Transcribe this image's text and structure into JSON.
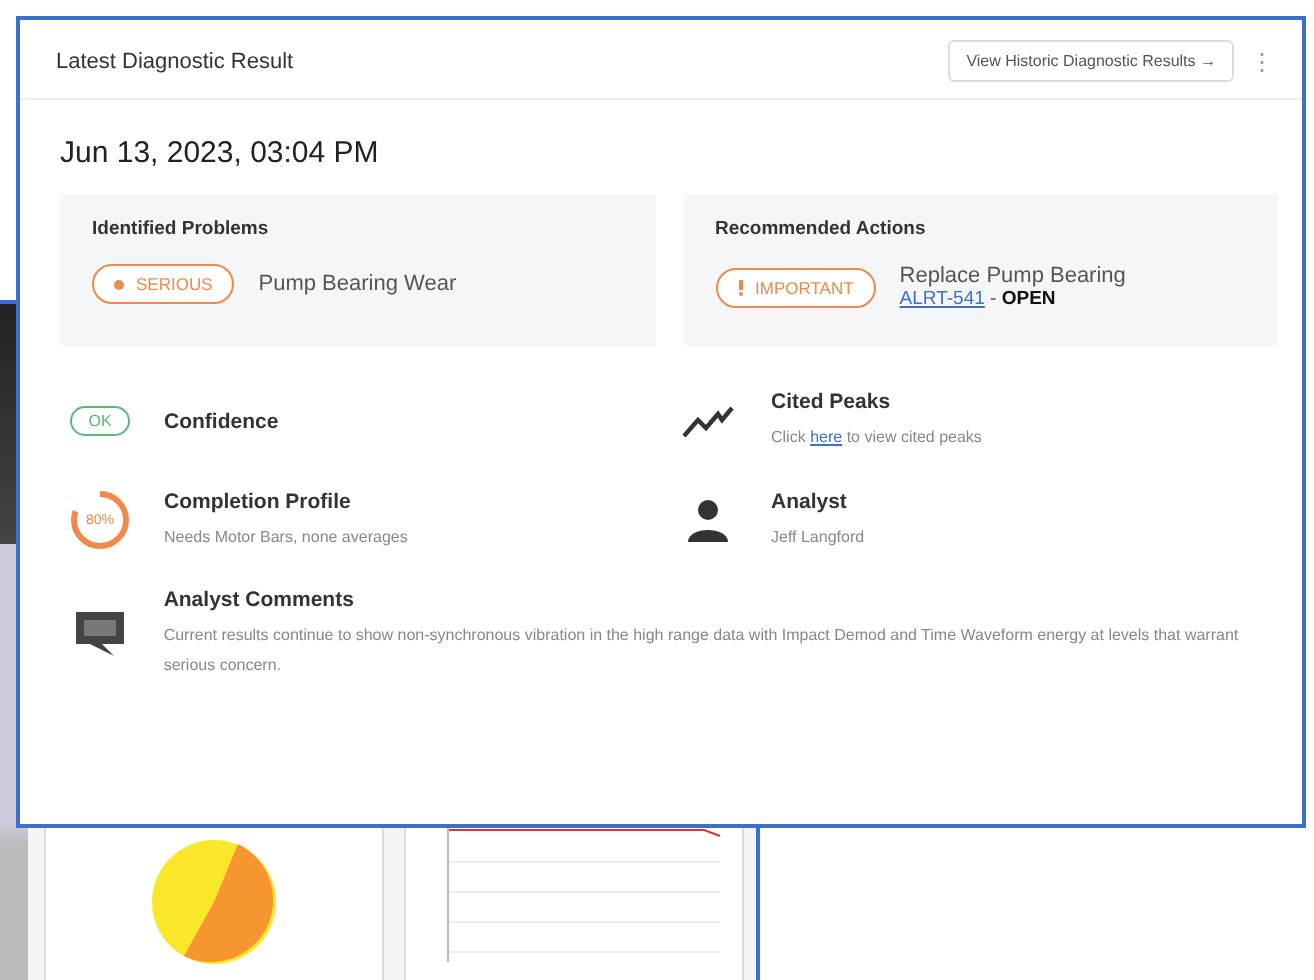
{
  "card": {
    "title": "Latest Diagnostic Result",
    "history_button": "View Historic Diagnostic Results",
    "history_arrow": "→",
    "menu": "⋮",
    "date": "Jun 13, 2023, 03:04 PM"
  },
  "problems": {
    "heading": "Identified Problems",
    "badge": {
      "label": "SERIOUS",
      "kind": "serious",
      "color": "#f0894a"
    },
    "text": "Pump Bearing Wear"
  },
  "actions": {
    "heading": "Recommended Actions",
    "badge": {
      "label": "IMPORTANT",
      "kind": "important",
      "color": "#f0894a"
    },
    "text": "Replace Pump Bearing",
    "link": "ALRT-541",
    "separator": "-",
    "status": "OPEN"
  },
  "details": [
    {
      "kind": "confidence",
      "badge": "OK",
      "title": "Confidence"
    },
    {
      "kind": "peaks",
      "title": "Cited Peaks",
      "before": "Click",
      "link": "here",
      "after": "to view cited peaks"
    },
    {
      "kind": "completion",
      "percent": "80%",
      "level": 0.8,
      "title": "Completion Profile",
      "text": "Needs Motor Bars, none averages"
    },
    {
      "kind": "analyst",
      "title": "Analyst",
      "text": "Jeff Langford"
    },
    {
      "kind": "comments",
      "title": "Analyst Comments",
      "text": "Current results continue to show non-synchronous vibration in the high range data with Impact Demod and Time Waveform energy at levels that warrant serious concern."
    }
  ]
}
